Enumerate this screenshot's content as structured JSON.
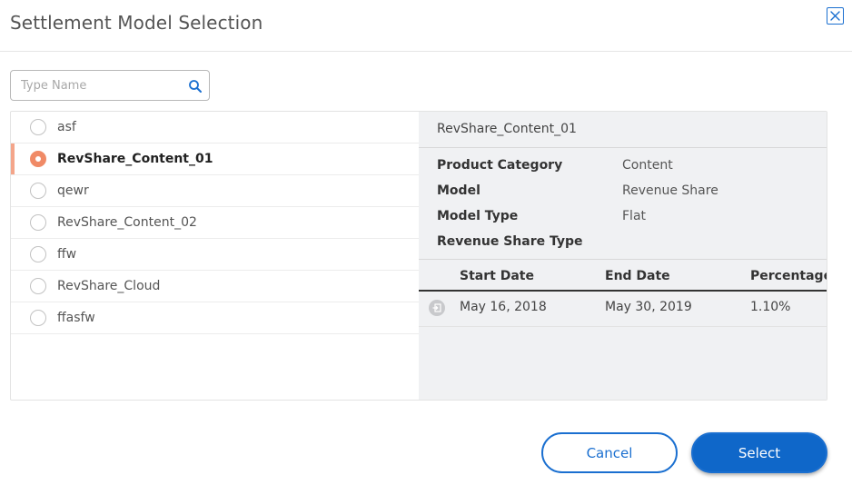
{
  "dialog": {
    "title": "Settlement Model Selection"
  },
  "search": {
    "placeholder": "Type Name",
    "value": ""
  },
  "models": [
    {
      "name": "asf",
      "selected": false
    },
    {
      "name": "RevShare_Content_01",
      "selected": true
    },
    {
      "name": "qewr",
      "selected": false
    },
    {
      "name": "RevShare_Content_02",
      "selected": false
    },
    {
      "name": "ffw",
      "selected": false
    },
    {
      "name": "RevShare_Cloud",
      "selected": false
    },
    {
      "name": "ffasfw",
      "selected": false
    }
  ],
  "details": {
    "title": "RevShare_Content_01",
    "properties": [
      {
        "label": "Product Category",
        "value": "Content"
      },
      {
        "label": "Model",
        "value": "Revenue Share"
      },
      {
        "label": "Model Type",
        "value": "Flat"
      },
      {
        "label": "Revenue Share Type",
        "value": ""
      }
    ],
    "table": {
      "headers": [
        "Start Date",
        "End Date",
        "Percentage"
      ],
      "rows": [
        [
          "May 16, 2018",
          "May 30, 2019",
          "1.10%"
        ]
      ]
    }
  },
  "buttons": {
    "cancel": "Cancel",
    "select": "Select"
  },
  "colors": {
    "accent": "#0f67c9",
    "selection": "#f08a66"
  }
}
